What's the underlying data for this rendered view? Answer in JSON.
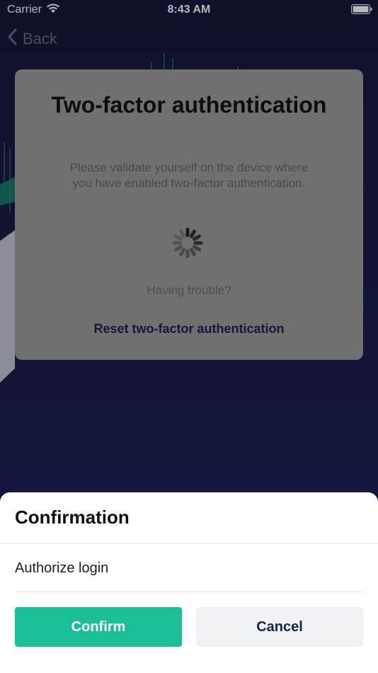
{
  "status_bar": {
    "carrier": "Carrier",
    "time": "8:43 AM"
  },
  "nav": {
    "back_label": "Back"
  },
  "two_factor": {
    "title": "Two-factor authentication",
    "description": "Please validate yourself on the device where you have enabled two-factor authentication.",
    "trouble_text": "Having trouble?",
    "reset_link": "Reset two-factor authentication"
  },
  "sheet": {
    "title": "Confirmation",
    "message": "Authorize login",
    "confirm_label": "Confirm",
    "cancel_label": "Cancel"
  },
  "colors": {
    "accent": "#1abf98",
    "cancel_text": "#14224f",
    "background": "#16173a"
  }
}
